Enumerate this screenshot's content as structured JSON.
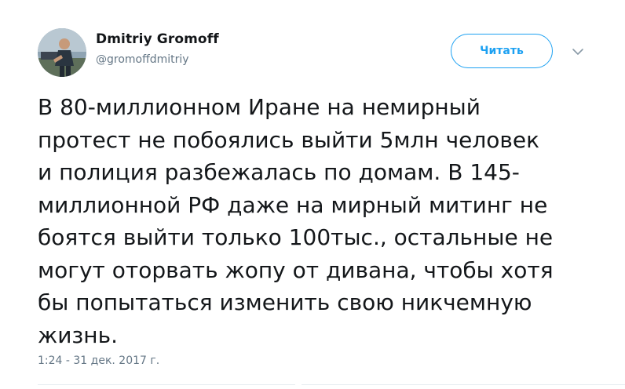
{
  "author": {
    "display_name": "Dmitriy Gromoff",
    "handle": "@gromoffdmitriy",
    "avatar": "user-avatar-photo"
  },
  "follow_button": {
    "label": "Читать"
  },
  "more_menu": {
    "icon": "chevron-down-icon"
  },
  "tweet": {
    "lines": [
      "В 80-миллионном Иране на немирный",
      "протест не побоялись выйти 5млн человек",
      "и полиция разбежалась по домам. В 145-",
      "миллионной РФ даже на мирный митинг не",
      "боятся выйти только 100тыс., остальные не",
      "могут оторвать жопу от дивана, чтобы хотя",
      "бы попытаться изменить свою никчемную",
      "жизнь."
    ],
    "timestamp": "1:24 - 31 дек. 2017 г."
  },
  "colors": {
    "accent": "#1da1f2",
    "text": "#14171a",
    "secondary_text": "#657786",
    "divider": "#e6ecf0"
  }
}
